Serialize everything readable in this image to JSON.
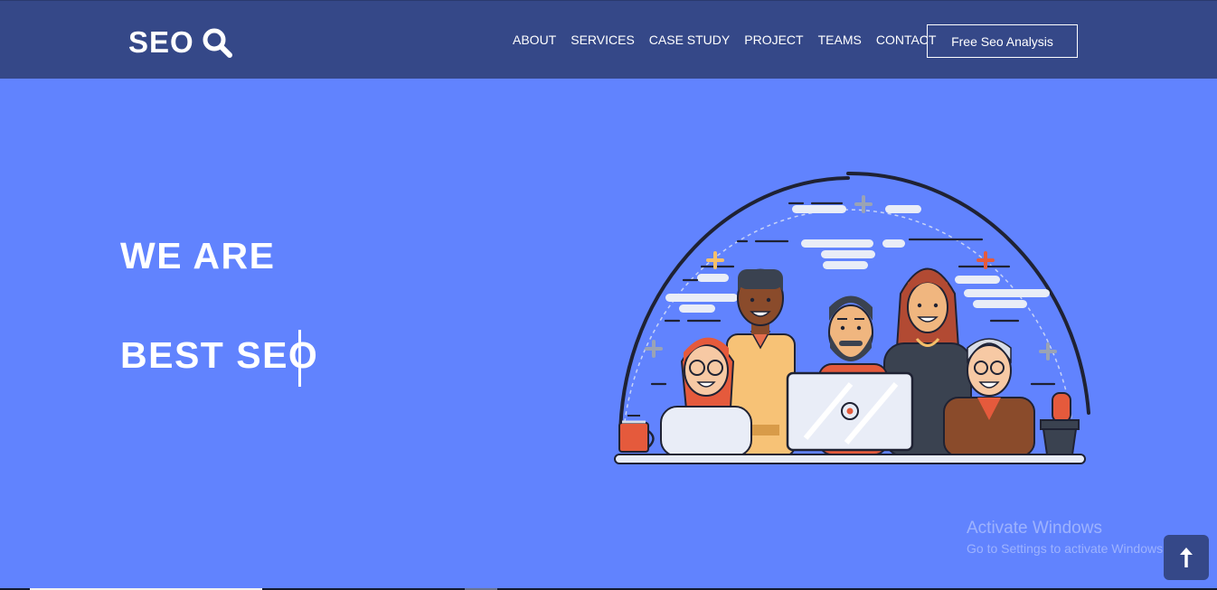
{
  "brand": {
    "name": "SEO",
    "icon": "search-icon"
  },
  "nav": {
    "items": [
      "ABOUT",
      "SERVICES",
      "CASE STUDY",
      "PROJECT",
      "TEAMS",
      "CONTACT"
    ],
    "cta_label": "Free Seo Analysis"
  },
  "hero": {
    "line1": "WE ARE",
    "line2": "BEST SEO",
    "illustration": "team-at-laptop-illustration"
  },
  "watermark": {
    "title": "Activate Windows",
    "subtitle": "Go to Settings to activate Windows."
  },
  "scroll_top": {
    "icon": "arrow-up-icon"
  },
  "colors": {
    "navbar": "#354888",
    "hero_bg": "#6183fe",
    "text": "#ffffff"
  }
}
